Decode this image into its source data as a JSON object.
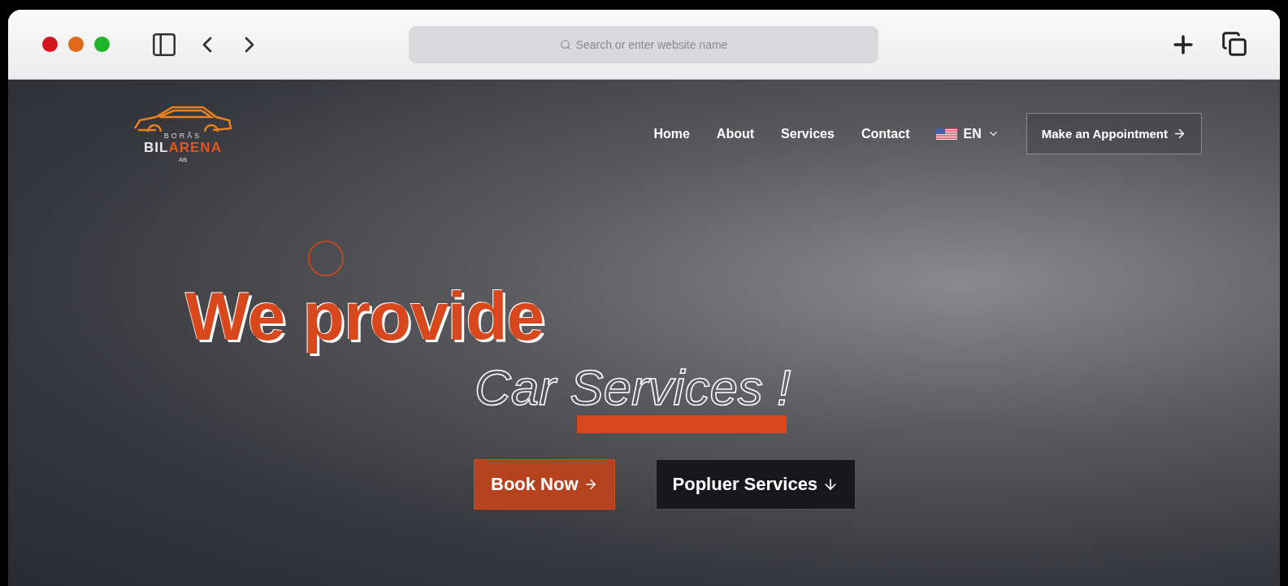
{
  "browser": {
    "address_bar": {
      "placeholder": "Search or enter website name"
    }
  },
  "logo": {
    "tagline": "BORÅS",
    "name_part_1": "BIL",
    "name_part_2": "ARENA",
    "suffix": "AB"
  },
  "nav": {
    "items": [
      {
        "label": "Home"
      },
      {
        "label": "About"
      },
      {
        "label": "Services"
      },
      {
        "label": "Contact"
      }
    ],
    "language": {
      "label": "EN"
    },
    "cta": {
      "label": "Make an Appointment"
    }
  },
  "hero": {
    "headline": "We provide",
    "subheadline": "Car Services !",
    "buttons": [
      {
        "kind": "primary",
        "label": "Book Now"
      },
      {
        "kind": "secondary",
        "label": "Popluer Services"
      }
    ]
  }
}
